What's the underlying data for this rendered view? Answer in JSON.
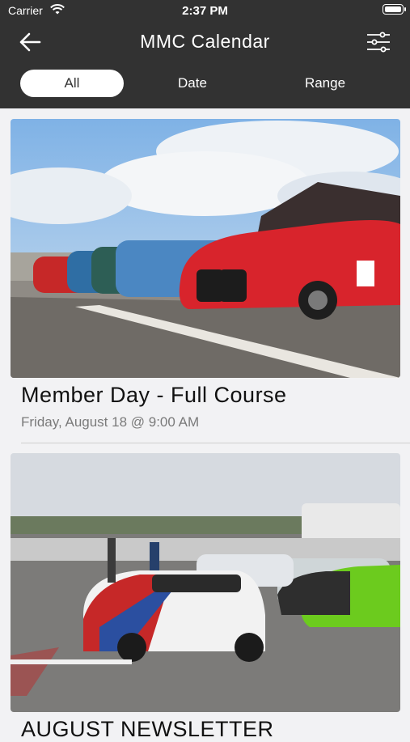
{
  "status_bar": {
    "carrier": "Carrier",
    "time": "2:37 PM"
  },
  "navbar": {
    "title": "MMC Calendar"
  },
  "tabs": [
    {
      "label": "All",
      "selected": true
    },
    {
      "label": "Date",
      "selected": false
    },
    {
      "label": "Range",
      "selected": false
    }
  ],
  "events": [
    {
      "title": "Member Day - Full Course",
      "date": "Friday, August 18 @ 9:00 AM"
    },
    {
      "title": "AUGUST NEWSLETTER",
      "date": ""
    }
  ],
  "colors": {
    "header_bg": "#323232",
    "page_bg": "#f2f2f4"
  },
  "icons": {
    "back": "arrow-left-icon",
    "filter": "sliders-icon",
    "wifi": "wifi-icon",
    "battery": "battery-icon"
  }
}
